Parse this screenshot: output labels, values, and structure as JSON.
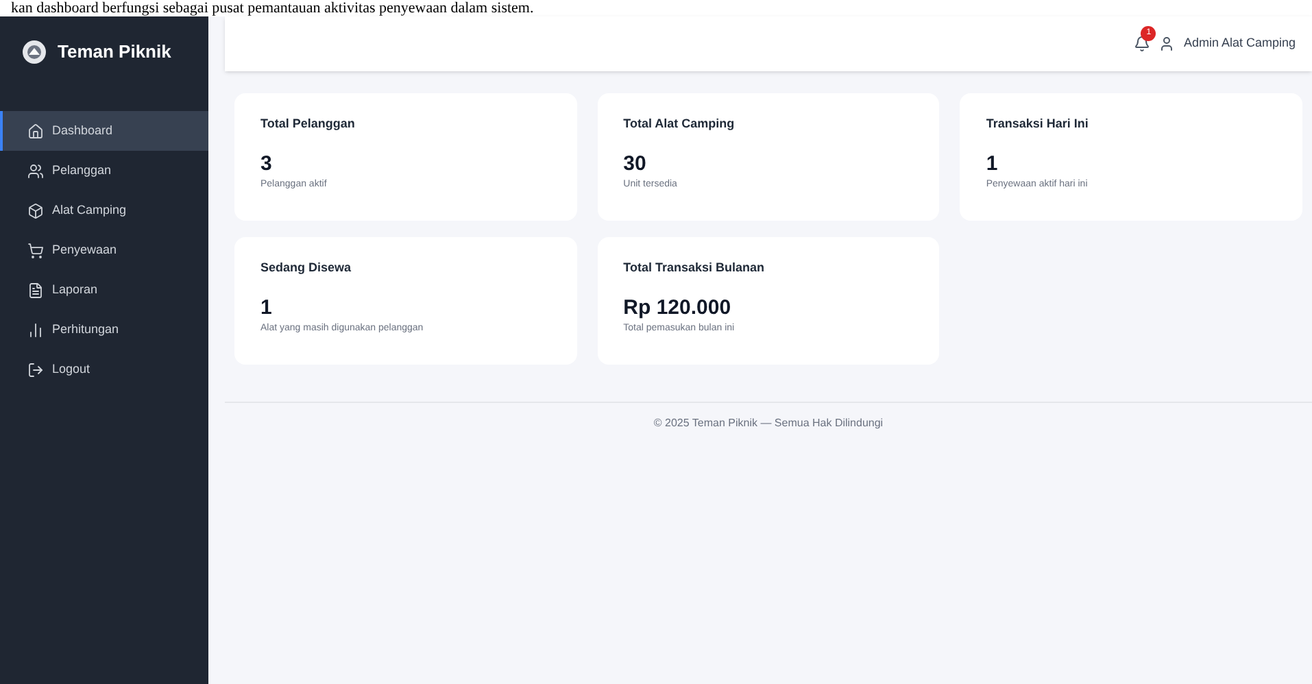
{
  "caption": "kan dashboard berfungsi sebagai pusat pemantauan aktivitas penyewaan dalam sistem.",
  "sidebar": {
    "brand": "Teman Piknik",
    "items": [
      {
        "kind": "home",
        "label": "Dashboard",
        "selected": true
      },
      {
        "kind": "users",
        "label": "Pelanggan",
        "selected": false
      },
      {
        "kind": "box",
        "label": "Alat Camping",
        "selected": false
      },
      {
        "kind": "cart",
        "label": "Penyewaan",
        "selected": false
      },
      {
        "kind": "file",
        "label": "Laporan",
        "selected": false
      },
      {
        "kind": "chart",
        "label": "Perhitungan",
        "selected": false
      },
      {
        "kind": "logout",
        "label": "Logout",
        "selected": false
      }
    ]
  },
  "header": {
    "notification_count": "1",
    "user": "Admin Alat Camping"
  },
  "cards": [
    {
      "title": "Total Pelanggan",
      "value": "3",
      "note": "Pelanggan aktif"
    },
    {
      "title": "Total Alat Camping",
      "value": "30",
      "note": "Unit tersedia"
    },
    {
      "title": "Transaksi Hari Ini",
      "value": "1",
      "note": "Penyewaan aktif hari ini"
    },
    {
      "title": "Sedang Disewa",
      "value": "1",
      "note": "Alat yang masih digunakan pelanggan"
    },
    {
      "title": "Total Transaksi Bulanan",
      "value": "Rp 120.000",
      "note": "Total pemasukan bulan ini"
    }
  ],
  "footer": "© 2025 Teman Piknik — Semua Hak Dilindungi"
}
